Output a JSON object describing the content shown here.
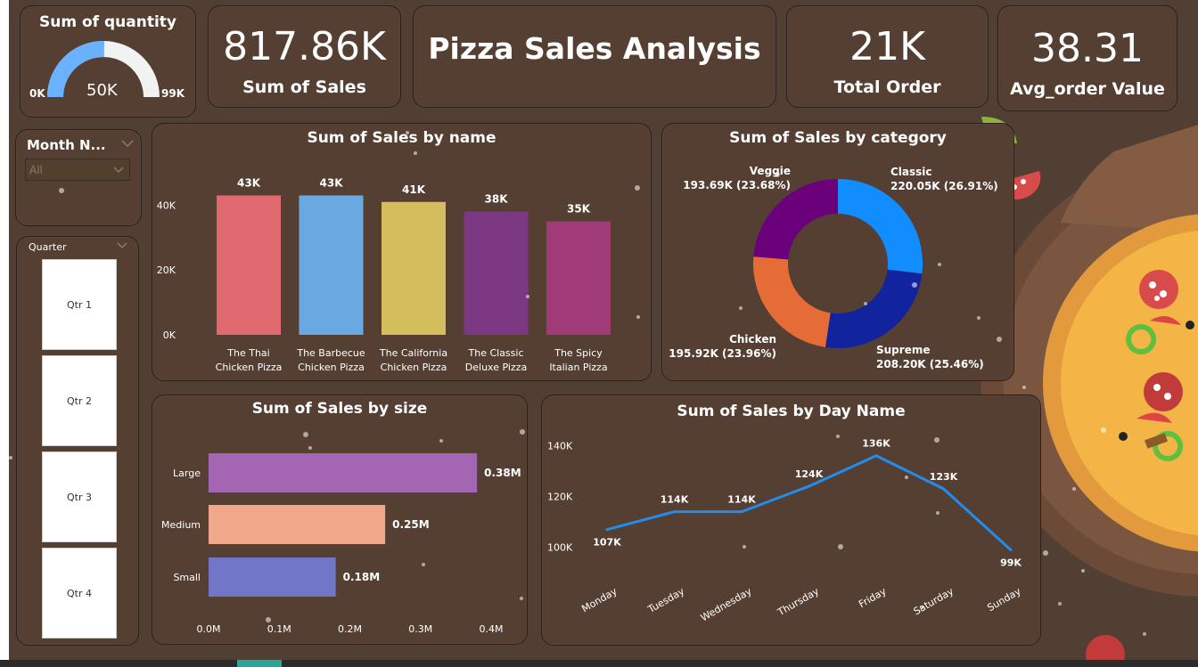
{
  "gauge": {
    "title": "Sum of quantity",
    "value_label": "50K",
    "min_label": "0K",
    "max_label": "99K",
    "value": 50,
    "max": 99,
    "fill_color": "#6ab2ff",
    "track_color": "#f2f2f2"
  },
  "kpis": {
    "sales": {
      "value": "817.86K",
      "label": "Sum of Sales"
    },
    "title": "Pizza Sales Analysis",
    "orders": {
      "value": "21K",
      "label": "Total Order"
    },
    "avg": {
      "value": "38.31",
      "label": "Avg_order Value"
    }
  },
  "slicers": {
    "month": {
      "title": "Month N...",
      "dropdown_value": "All",
      "chevron": "chevron-down-icon"
    },
    "quarter": {
      "title": "Quarter",
      "chevron": "chevron-down-icon",
      "options": [
        "Qtr 1",
        "Qtr 2",
        "Qtr 3",
        "Qtr 4"
      ]
    }
  },
  "chart_data": [
    {
      "id": "by_name",
      "type": "bar",
      "title": "Sum of Sales by name",
      "categories": [
        [
          "The Thai",
          "Chicken Pizza"
        ],
        [
          "The Barbecue",
          "Chicken Pizza"
        ],
        [
          "The California",
          "Chicken Pizza"
        ],
        [
          "The Classic",
          "Deluxe Pizza"
        ],
        [
          "The Spicy",
          "Italian Pizza"
        ]
      ],
      "values": [
        43,
        43,
        41,
        38,
        35
      ],
      "data_labels": [
        "43K",
        "43K",
        "41K",
        "38K",
        "35K"
      ],
      "colors": [
        "#e16a70",
        "#6aa8e2",
        "#d4bd5c",
        "#7d3884",
        "#a03b78"
      ],
      "yticks": [
        "0K",
        "20K",
        "40K"
      ],
      "ylim": [
        0,
        50
      ]
    },
    {
      "id": "by_category",
      "type": "pie",
      "title": "Sum of Sales by category",
      "slices": [
        {
          "name": "Classic",
          "value": 220.05,
          "label": "220.05K (26.91%)",
          "color": "#118dff"
        },
        {
          "name": "Supreme",
          "value": 208.2,
          "label": "208.20K (25.46%)",
          "color": "#12239e"
        },
        {
          "name": "Chicken",
          "value": 195.92,
          "label": "195.92K (23.96%)",
          "color": "#e66c37"
        },
        {
          "name": "Veggie",
          "value": 193.69,
          "label": "193.69K (23.68%)",
          "color": "#6b007b"
        }
      ]
    },
    {
      "id": "by_size",
      "type": "bar",
      "orientation": "horizontal",
      "title": "Sum of Sales by size",
      "categories": [
        "Large",
        "Medium",
        "Small"
      ],
      "values": [
        0.38,
        0.25,
        0.18
      ],
      "data_labels": [
        "0.38M",
        "0.25M",
        "0.18M"
      ],
      "colors": [
        "#a466b3",
        "#f1a78a",
        "#7177c6"
      ],
      "xticks": [
        "0.0M",
        "0.1M",
        "0.2M",
        "0.3M",
        "0.4M"
      ],
      "xlim": [
        0,
        0.4
      ]
    },
    {
      "id": "by_day",
      "type": "line",
      "title": "Sum of Sales by Day Name",
      "categories": [
        "Monday",
        "Tuesday",
        "Wednesday",
        "Thursday",
        "Friday",
        "Saturday",
        "Sunday"
      ],
      "values": [
        107,
        114,
        114,
        124,
        136,
        123,
        99
      ],
      "data_labels": [
        "107K",
        "114K",
        "114K",
        "124K",
        "136K",
        "123K",
        "99K"
      ],
      "color": "#1f8ef0",
      "yticks": [
        "100K",
        "120K",
        "140K"
      ],
      "ylim": [
        95,
        145
      ]
    }
  ]
}
